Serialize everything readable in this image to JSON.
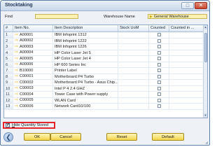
{
  "window": {
    "title": "Stocktaking"
  },
  "find": {
    "label": "Find",
    "value": ""
  },
  "warehouse": {
    "label": "Warehouse Name",
    "value": "General Warehouse"
  },
  "table": {
    "columns": [
      "#",
      "Item No.",
      "Item Description",
      "Stock UoM",
      "Counted",
      "Counted in ..."
    ],
    "rows": [
      {
        "num": "1",
        "code": "A00001",
        "desc": "IBM Infoprint 1312",
        "uom": "",
        "counted": false,
        "countin": ""
      },
      {
        "num": "2",
        "code": "A00002",
        "desc": "IBM Infoprint 1222",
        "uom": "",
        "counted": false,
        "countin": ""
      },
      {
        "num": "3",
        "code": "A00003",
        "desc": "IBM Infoprint 1226",
        "uom": "",
        "counted": false,
        "countin": ""
      },
      {
        "num": "4",
        "code": "A00004",
        "desc": "HP Color Laser Jet 5",
        "uom": "",
        "counted": false,
        "countin": ""
      },
      {
        "num": "5",
        "code": "A00005",
        "desc": "HP Color Laser Jet 4",
        "uom": "",
        "counted": false,
        "countin": ""
      },
      {
        "num": "6",
        "code": "A00006",
        "desc": "HP 600 Series Inc",
        "uom": "",
        "counted": false,
        "countin": ""
      },
      {
        "num": "7",
        "code": "B10000",
        "desc": "Printer Label",
        "uom": "",
        "counted": false,
        "countin": ""
      },
      {
        "num": "8",
        "code": "C00001",
        "desc": "Motherboard P4 Turbo",
        "uom": "",
        "counted": false,
        "countin": ""
      },
      {
        "num": "9",
        "code": "C00002",
        "desc": "Motherboard P4 Turbo - Asus Chip...",
        "uom": "",
        "counted": false,
        "countin": ""
      },
      {
        "num": "10",
        "code": "C00003",
        "desc": "Intel P 4 2.4 GHZ",
        "uom": "",
        "counted": false,
        "countin": ""
      },
      {
        "num": "11",
        "code": "C00004",
        "desc": "Tower Case with Power supply",
        "uom": "",
        "counted": false,
        "countin": ""
      },
      {
        "num": "12",
        "code": "C00005",
        "desc": "WLAN Card",
        "uom": "",
        "counted": false,
        "countin": ""
      },
      {
        "num": "13",
        "code": "C00006",
        "desc": "Network Card10/100",
        "uom": "",
        "counted": false,
        "countin": ""
      }
    ]
  },
  "hide_quantity": {
    "label_prefix": "H",
    "label_rest": "ide Quantity Stored",
    "checked": true,
    "check_glyph": "✔"
  },
  "buttons": {
    "ok": "OK",
    "cancel": "Cancel",
    "reset": "Reset",
    "default": "Default"
  },
  "icons": {
    "maximize": "□",
    "close": "✕",
    "link_arrow": "⇨",
    "warehouse_link": "▶",
    "scroll_up": "▲",
    "scroll_down": "▼",
    "nav_back": "❮",
    "resize_grip": "◢"
  }
}
